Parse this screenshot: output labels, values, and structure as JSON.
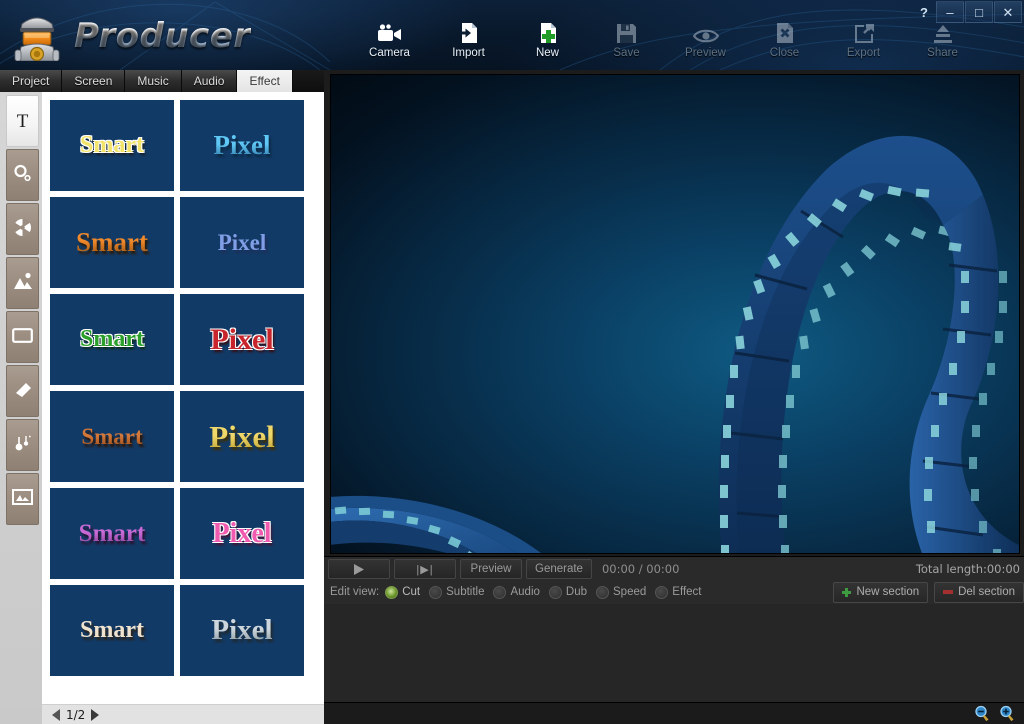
{
  "window": {
    "title": "Producer",
    "buttons": [
      {
        "name": "help-button",
        "label": "?"
      },
      {
        "name": "minimize-button",
        "label": "–"
      },
      {
        "name": "maximize-button",
        "label": "□"
      },
      {
        "name": "close-button",
        "label": "✕"
      }
    ]
  },
  "toolbar": {
    "items": [
      {
        "label": "Camera",
        "icon": "camera-icon",
        "enabled": true
      },
      {
        "label": "Import",
        "icon": "import-icon",
        "enabled": true
      },
      {
        "label": "New",
        "icon": "new-icon",
        "enabled": true
      },
      {
        "label": "Save",
        "icon": "save-icon",
        "enabled": false
      },
      {
        "label": "Preview",
        "icon": "preview-eye-icon",
        "enabled": false
      },
      {
        "label": "Close",
        "icon": "close-file-icon",
        "enabled": false
      },
      {
        "label": "Export",
        "icon": "export-icon",
        "enabled": false
      },
      {
        "label": "Share",
        "icon": "share-icon",
        "enabled": false
      }
    ]
  },
  "tabs": {
    "items": [
      {
        "label": "Project",
        "active": false
      },
      {
        "label": "Screen",
        "active": false
      },
      {
        "label": "Music",
        "active": false
      },
      {
        "label": "Audio",
        "active": false
      },
      {
        "label": "Effect",
        "active": true
      }
    ]
  },
  "rail": {
    "items": [
      {
        "name": "text-tool",
        "glyph": "T",
        "selected": true
      },
      {
        "name": "bubbles-tool",
        "glyph": "bubbles-icon",
        "selected": false
      },
      {
        "name": "aperture-tool",
        "glyph": "aperture-icon",
        "selected": false
      },
      {
        "name": "landscape-tool",
        "glyph": "landscape-icon",
        "selected": false
      },
      {
        "name": "frame-tool",
        "glyph": "rectangle-frame-icon",
        "selected": false
      },
      {
        "name": "shape-tool",
        "glyph": "cone-shape-icon",
        "selected": false
      },
      {
        "name": "sparkle-tool",
        "glyph": "sparkle-icon",
        "selected": false
      },
      {
        "name": "picture-tool",
        "glyph": "picture-frame-icon",
        "selected": false
      }
    ]
  },
  "effects": {
    "background": "#123a66",
    "thumbnails": [
      {
        "text": "Smart",
        "color": "#f2e36a",
        "outline": "#ffffff",
        "shadow": "#1a1a1a",
        "size": 24,
        "style": "outline"
      },
      {
        "text": "Pixel",
        "color": "#5fc8f5",
        "outline": "#2a6f9e",
        "shadow": "#0b2a44",
        "size": 27,
        "style": "gradient"
      },
      {
        "text": "Smart",
        "color": "#f0892a",
        "outline": "#8a4a12",
        "shadow": "#2a1a08",
        "size": 27,
        "style": "gradient"
      },
      {
        "text": "Pixel",
        "color": "#7f9ee6",
        "outline": "#4a6bbd",
        "shadow": "#1f2f5a",
        "size": 23,
        "style": "flat"
      },
      {
        "text": "Smart",
        "color": "#2aa02a",
        "outline": "#ffffff",
        "shadow": "#0a2a0a",
        "size": 24,
        "style": "outline"
      },
      {
        "text": "Pixel",
        "color": "#c8262c",
        "outline": "#ffffff",
        "shadow": "#3a0a0c",
        "size": 30,
        "style": "outline"
      },
      {
        "text": "Smart",
        "color": "#d4783a",
        "outline": "#8c4416",
        "shadow": "#2a1406",
        "size": 23,
        "style": "gradient"
      },
      {
        "text": "Pixel",
        "color": "#f0d86a",
        "outline": "#b79a2a",
        "shadow": "#3a300a",
        "size": 31,
        "style": "gradient"
      },
      {
        "text": "Smart",
        "color": "#c96ad6",
        "outline": "#7b3a8c",
        "shadow": "#2a1030",
        "size": 25,
        "style": "gradient"
      },
      {
        "text": "Pixel",
        "color": "#f05bb0",
        "outline": "#ffffff",
        "shadow": "#4a1030",
        "size": 28,
        "style": "outline"
      },
      {
        "text": "Smart",
        "color": "#efe3cf",
        "outline": "#b09b82",
        "shadow": "#2a2218",
        "size": 24,
        "style": "flat"
      },
      {
        "text": "Pixel",
        "color": "#cdd6dc",
        "outline": "#7d8c96",
        "shadow": "#1e2a32",
        "size": 29,
        "style": "gradient"
      }
    ],
    "pager": {
      "current": "1/2",
      "prev": "◀",
      "next": "▶"
    }
  },
  "player": {
    "play_button": "▶",
    "frame_button": "|▶|",
    "preview_label": "Preview",
    "generate_label": "Generate",
    "timecode": "00:00 / 00:00",
    "total_length": "Total length:00:00"
  },
  "edit_view": {
    "label": "Edit view:",
    "options": [
      {
        "label": "Cut",
        "selected": true
      },
      {
        "label": "Subtitle",
        "selected": false
      },
      {
        "label": "Audio",
        "selected": false
      },
      {
        "label": "Dub",
        "selected": false
      },
      {
        "label": "Speed",
        "selected": false
      },
      {
        "label": "Effect",
        "selected": false
      }
    ],
    "new_section_label": "New section",
    "del_section_label": "Del section"
  },
  "status": {
    "zoom_out_icon": "zoom-out-icon",
    "zoom_in_icon": "zoom-in-icon"
  }
}
